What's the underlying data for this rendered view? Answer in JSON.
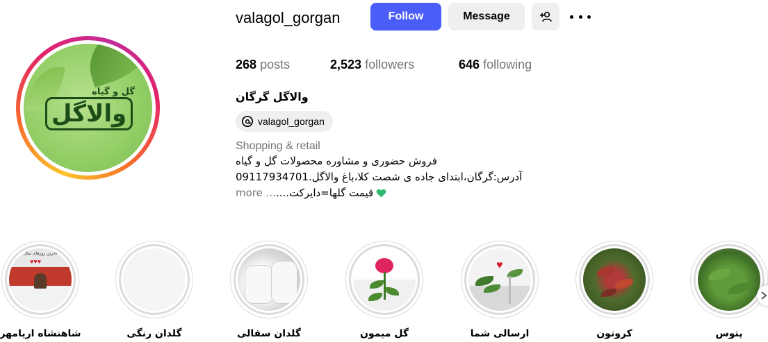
{
  "profile": {
    "username": "valagol_gorgan",
    "follow_label": "Follow",
    "message_label": "Message",
    "suggest_icon": "person-add-icon",
    "more_icon": "more-options-icon",
    "avatar_logo_small": "گل و گیاه",
    "avatar_logo_big": "والاگل"
  },
  "stats": {
    "posts_count": "268",
    "posts_label": "posts",
    "followers_count": "2,523",
    "followers_label": "followers",
    "following_count": "646",
    "following_label": "following"
  },
  "bio": {
    "full_name": "والاگل گرگان",
    "threads_handle": "valagol_gorgan",
    "category": "Shopping & retail",
    "line1": "فروش حضوری و مشاوره محصولات گل و گیاه",
    "line2": "آدرس:گرگان،ابتدای جاده ی شصت کلا،باغ والاگل.09117934701",
    "line3": "قیمت گلها=دایرکت....",
    "more_label": "... more"
  },
  "highlights": [
    {
      "label": "شاهنشاه اریامهر",
      "image_text": "آخرین روزهای سال"
    },
    {
      "label": "گلدان رنگی"
    },
    {
      "label": "گلدان سفالی"
    },
    {
      "label": "گل میمون"
    },
    {
      "label": "ارسالی شما"
    },
    {
      "label": "کروتون"
    },
    {
      "label": "پتوس"
    }
  ],
  "colors": {
    "follow_button": "#4a5df9",
    "secondary_button": "#efefef",
    "muted_text": "#737373",
    "heart_emoji": "#2fb86e"
  }
}
